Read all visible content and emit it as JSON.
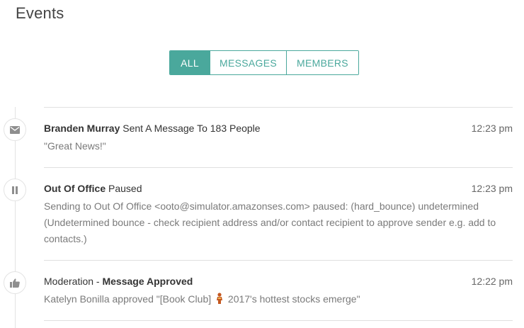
{
  "page": {
    "title": "Events"
  },
  "filters": {
    "items": [
      {
        "label": "ALL",
        "active": true
      },
      {
        "label": "MESSAGES",
        "active": false
      },
      {
        "label": "MEMBERS",
        "active": false
      }
    ]
  },
  "colors": {
    "accent": "#4aa89c",
    "text": "#333333",
    "muted": "#7a7a7a",
    "divider": "#e0e0e0"
  },
  "events": [
    {
      "icon": "envelope-icon",
      "actor": "Branden Murray",
      "action": " Sent A Message To 183 People",
      "time": "12:23 pm",
      "body": "\"Great News!\""
    },
    {
      "icon": "pause-icon",
      "actor": "Out Of Office",
      "action": " Paused",
      "time": "12:23 pm",
      "body": "Sending to Out Of Office <ooto@simulator.amazonses.com> paused: (hard_bounce) undetermined (Undetermined bounce - check recipient address and/or contact recipient to approve sender e.g. add to contacts.)"
    },
    {
      "icon": "thumbs-up-icon",
      "prefix": "Moderation - ",
      "title": "Message Approved",
      "time": "12:22 pm",
      "body_before": "Katelyn Bonilla approved \"[Book Club] ",
      "body_after": " 2017's hottest stocks emerge\""
    }
  ]
}
